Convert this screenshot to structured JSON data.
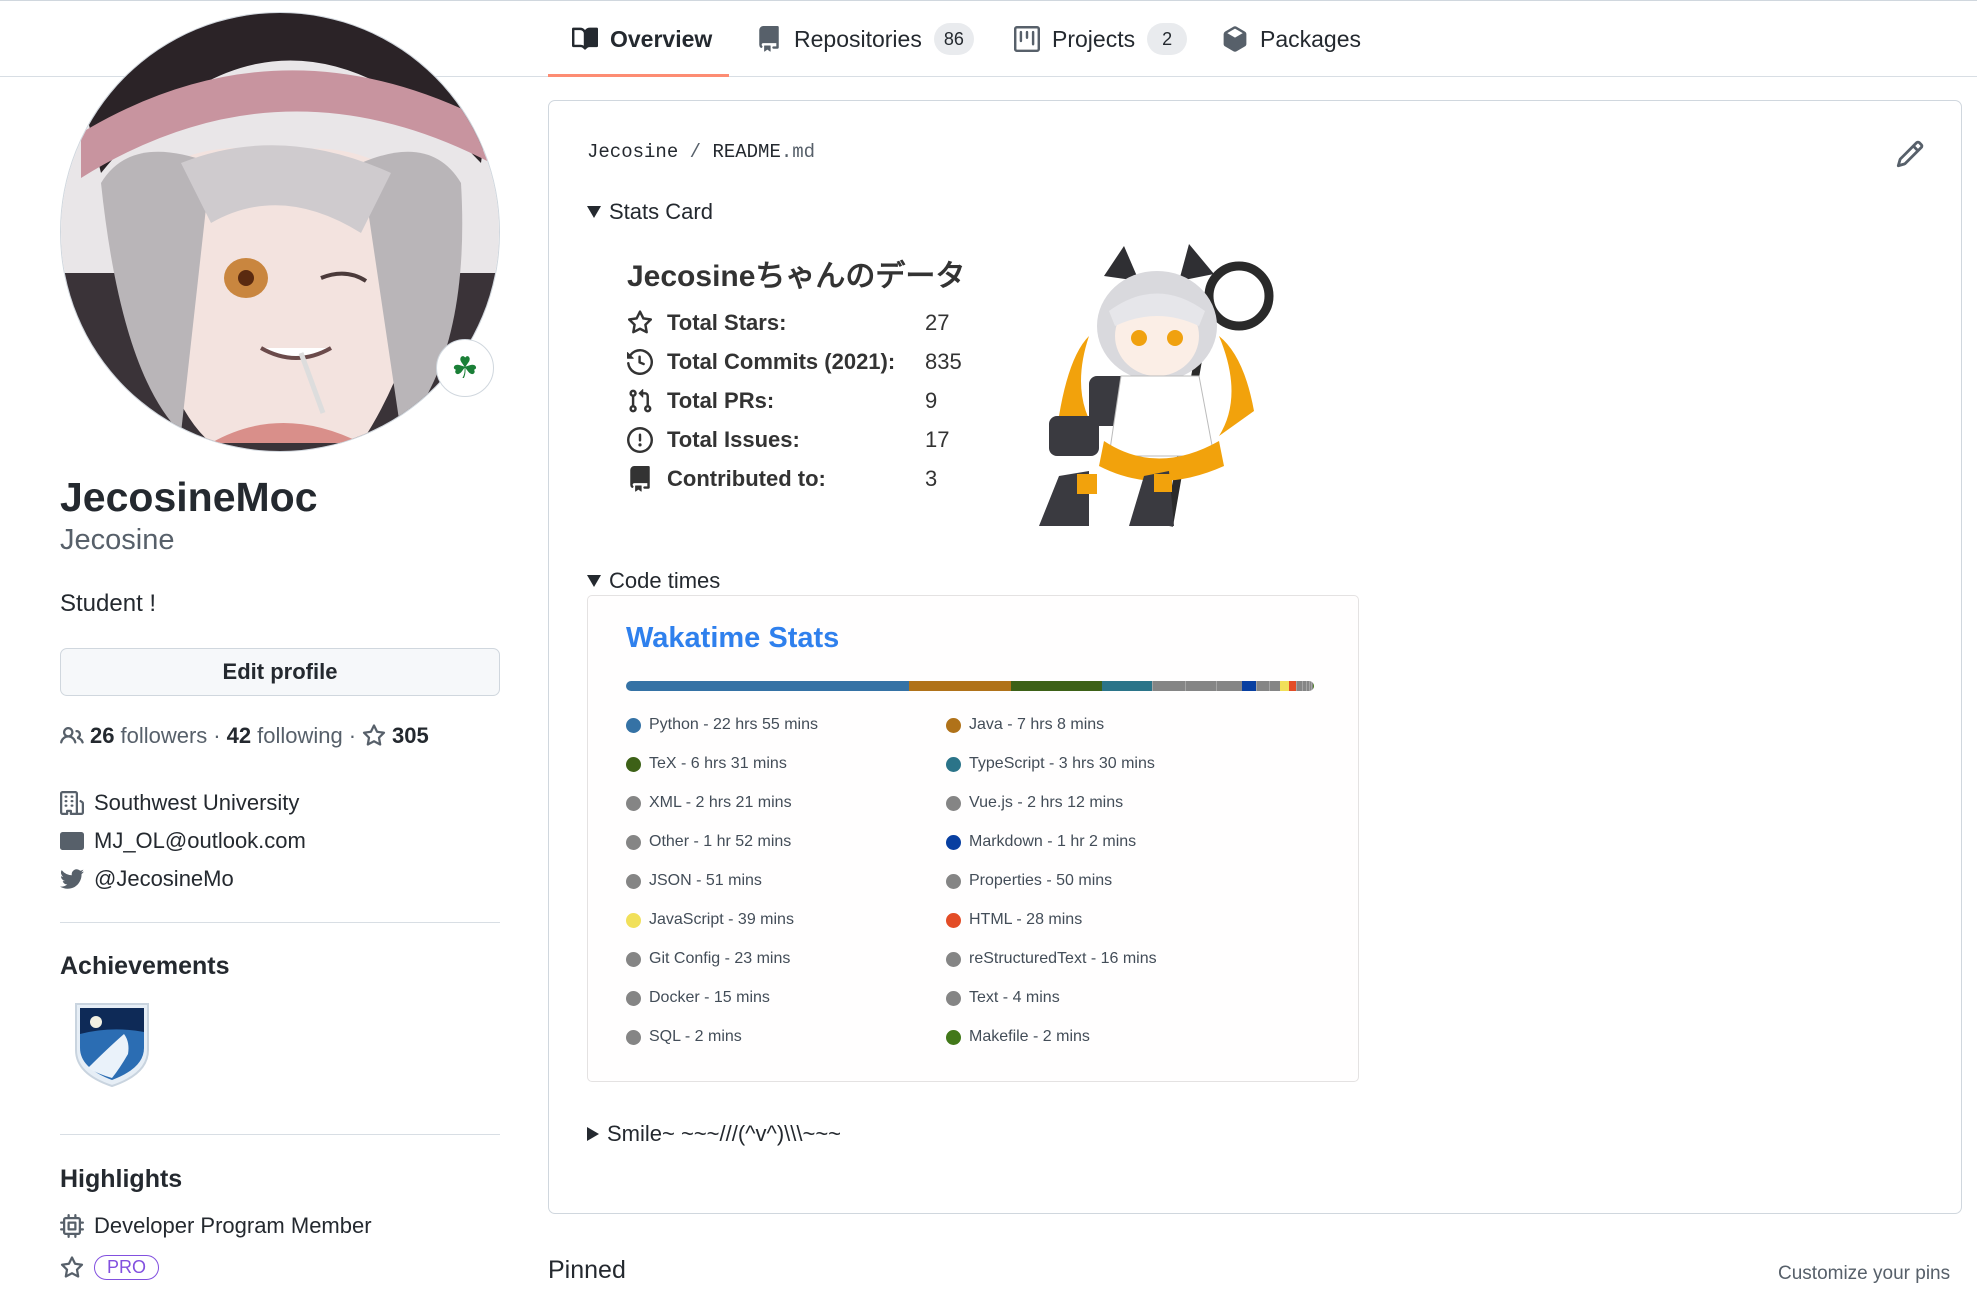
{
  "tabs": [
    {
      "label": "Overview",
      "selected": true
    },
    {
      "label": "Repositories",
      "count": "86"
    },
    {
      "label": "Projects",
      "count": "2"
    },
    {
      "label": "Packages"
    }
  ],
  "profile": {
    "fullname": "JecosineMoc",
    "username": "Jecosine",
    "bio": "Student !",
    "edit_label": "Edit profile",
    "status_icon": "shamrock-icon",
    "followers_count": "26",
    "followers_label": "followers",
    "following_count": "42",
    "following_label": "following",
    "stars_count": "305",
    "organization": "Southwest University",
    "email": "MJ_OL@outlook.com",
    "twitter": "@JecosineMo"
  },
  "achievements": {
    "heading": "Achievements"
  },
  "highlights": {
    "heading": "Highlights",
    "developer_member": "Developer Program Member",
    "pro_label": "PRO"
  },
  "readme": {
    "owner": "Jecosine",
    "separator": "/",
    "file_name": "README",
    "file_ext": ".md",
    "stats_summary": "Stats Card",
    "code_times_summary": "Code times",
    "smile_summary": "Smile~ ~~~///(^v^)\\\\\\~~~"
  },
  "stats_card": {
    "title": "Jecosineちゃんのデータ",
    "rows": [
      {
        "label": "Total Stars:",
        "value": "27",
        "icon": "star-icon"
      },
      {
        "label": "Total Commits (2021):",
        "value": "835",
        "icon": "history-icon"
      },
      {
        "label": "Total PRs:",
        "value": "9",
        "icon": "pull-request-icon"
      },
      {
        "label": "Total Issues:",
        "value": "17",
        "icon": "issue-icon"
      },
      {
        "label": "Contributed to:",
        "value": "3",
        "icon": "repo-icon"
      }
    ]
  },
  "wakatime": {
    "title": "Wakatime Stats",
    "languages": [
      {
        "text": "Python - 22 hrs 55 mins",
        "color": "#3572A5",
        "share": 0.412
      },
      {
        "text": "Java - 7 hrs 8 mins",
        "color": "#b07219",
        "share": 0.147
      },
      {
        "text": "TeX - 6 hrs 31 mins",
        "color": "#3D6117",
        "share": 0.133
      },
      {
        "text": "TypeScript - 3 hrs 30 mins",
        "color": "#2b7489",
        "share": 0.072
      },
      {
        "text": "XML - 2 hrs 21 mins",
        "color": "#858585",
        "share": 0.048
      },
      {
        "text": "Vue.js - 2 hrs 12 mins",
        "color": "#858585",
        "share": 0.045
      },
      {
        "text": "Other - 1 hr 52 mins",
        "color": "#858585",
        "share": 0.038
      },
      {
        "text": "Markdown - 1 hr 2 mins",
        "color": "#083fa1",
        "share": 0.021
      },
      {
        "text": "JSON - 51 mins",
        "color": "#858585",
        "share": 0.018
      },
      {
        "text": "Properties - 50 mins",
        "color": "#858585",
        "share": 0.017
      },
      {
        "text": "JavaScript - 39 mins",
        "color": "#f1e05a",
        "share": 0.013
      },
      {
        "text": "HTML - 28 mins",
        "color": "#e34c26",
        "share": 0.01
      },
      {
        "text": "Git Config - 23 mins",
        "color": "#858585",
        "share": 0.008
      },
      {
        "text": "reStructuredText - 16 mins",
        "color": "#858585",
        "share": 0.006
      },
      {
        "text": "Docker - 15 mins",
        "color": "#858585",
        "share": 0.005
      },
      {
        "text": "Text - 4 mins",
        "color": "#858585",
        "share": 0.003
      },
      {
        "text": "SQL - 2 mins",
        "color": "#858585",
        "share": 0.002
      },
      {
        "text": "Makefile - 2 mins",
        "color": "#427819",
        "share": 0.002
      }
    ]
  },
  "pinned": {
    "heading": "Pinned",
    "customize_label": "Customize your pins"
  }
}
